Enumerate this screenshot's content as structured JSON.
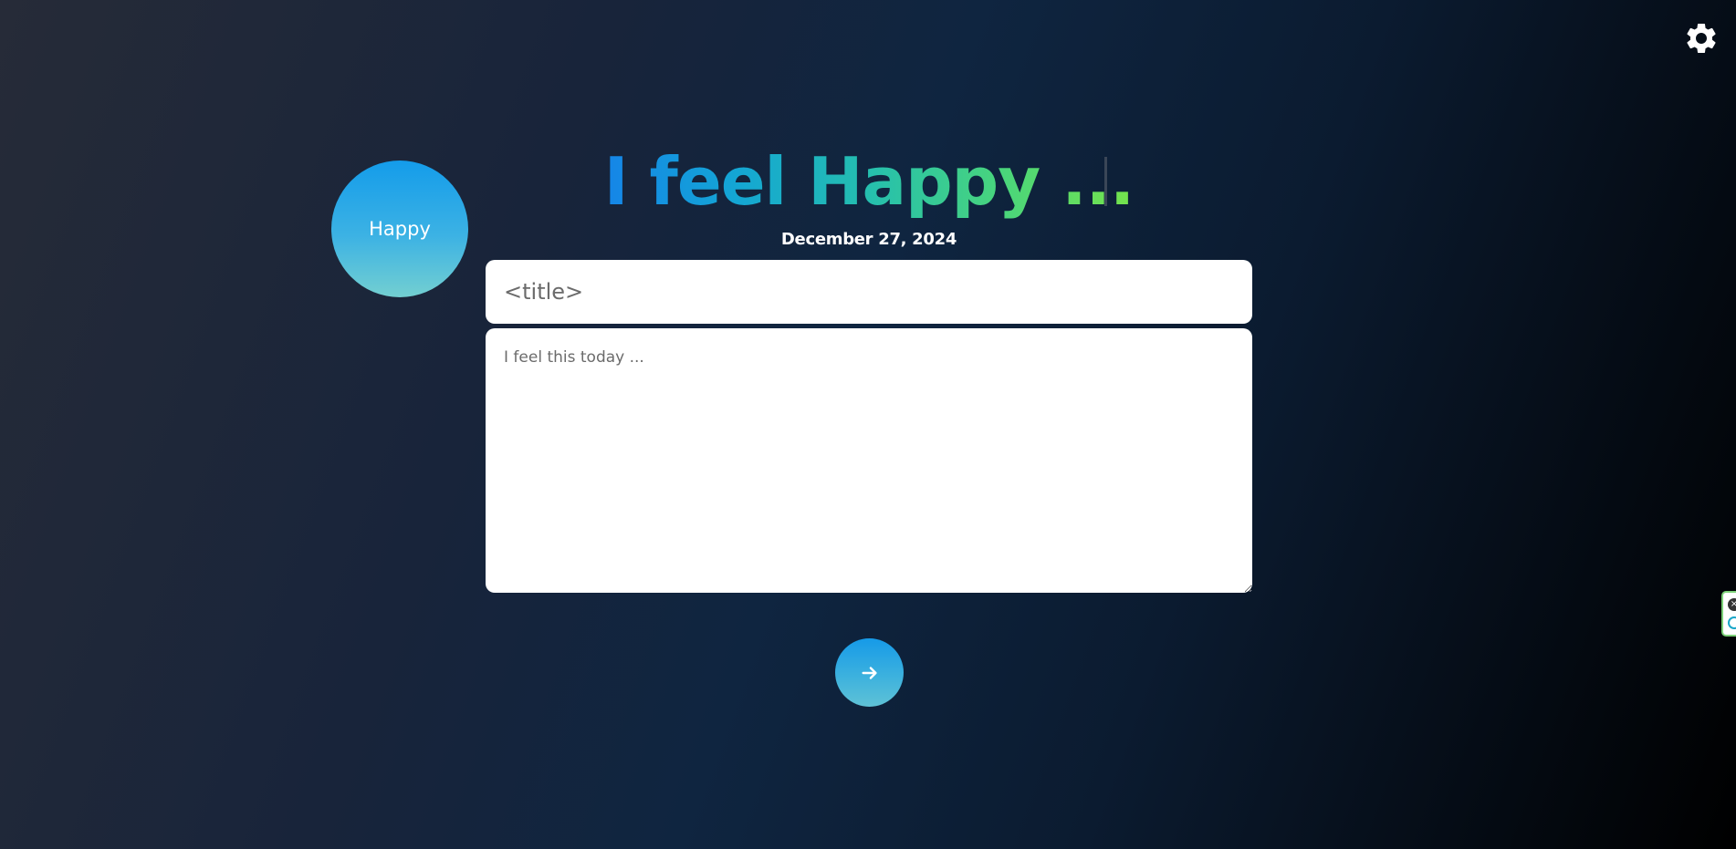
{
  "header": {
    "settings_icon": "gear-icon"
  },
  "mood": {
    "label": "Happy"
  },
  "headline": {
    "text": "I feel Happy ..."
  },
  "entry": {
    "date": "December 27, 2024",
    "title_placeholder": "<title>",
    "title_value": "",
    "body_placeholder": "I feel this today ...",
    "body_value": ""
  },
  "submit": {
    "icon": "arrow-right-icon"
  },
  "extension_widget": {
    "close_icon": "close-icon",
    "logo_icon": "extension-logo-icon"
  },
  "colors": {
    "gradient_start": "#1585e8",
    "gradient_end": "#75e34c",
    "circle_top": "#149cea",
    "circle_bottom": "#73cfd1"
  }
}
